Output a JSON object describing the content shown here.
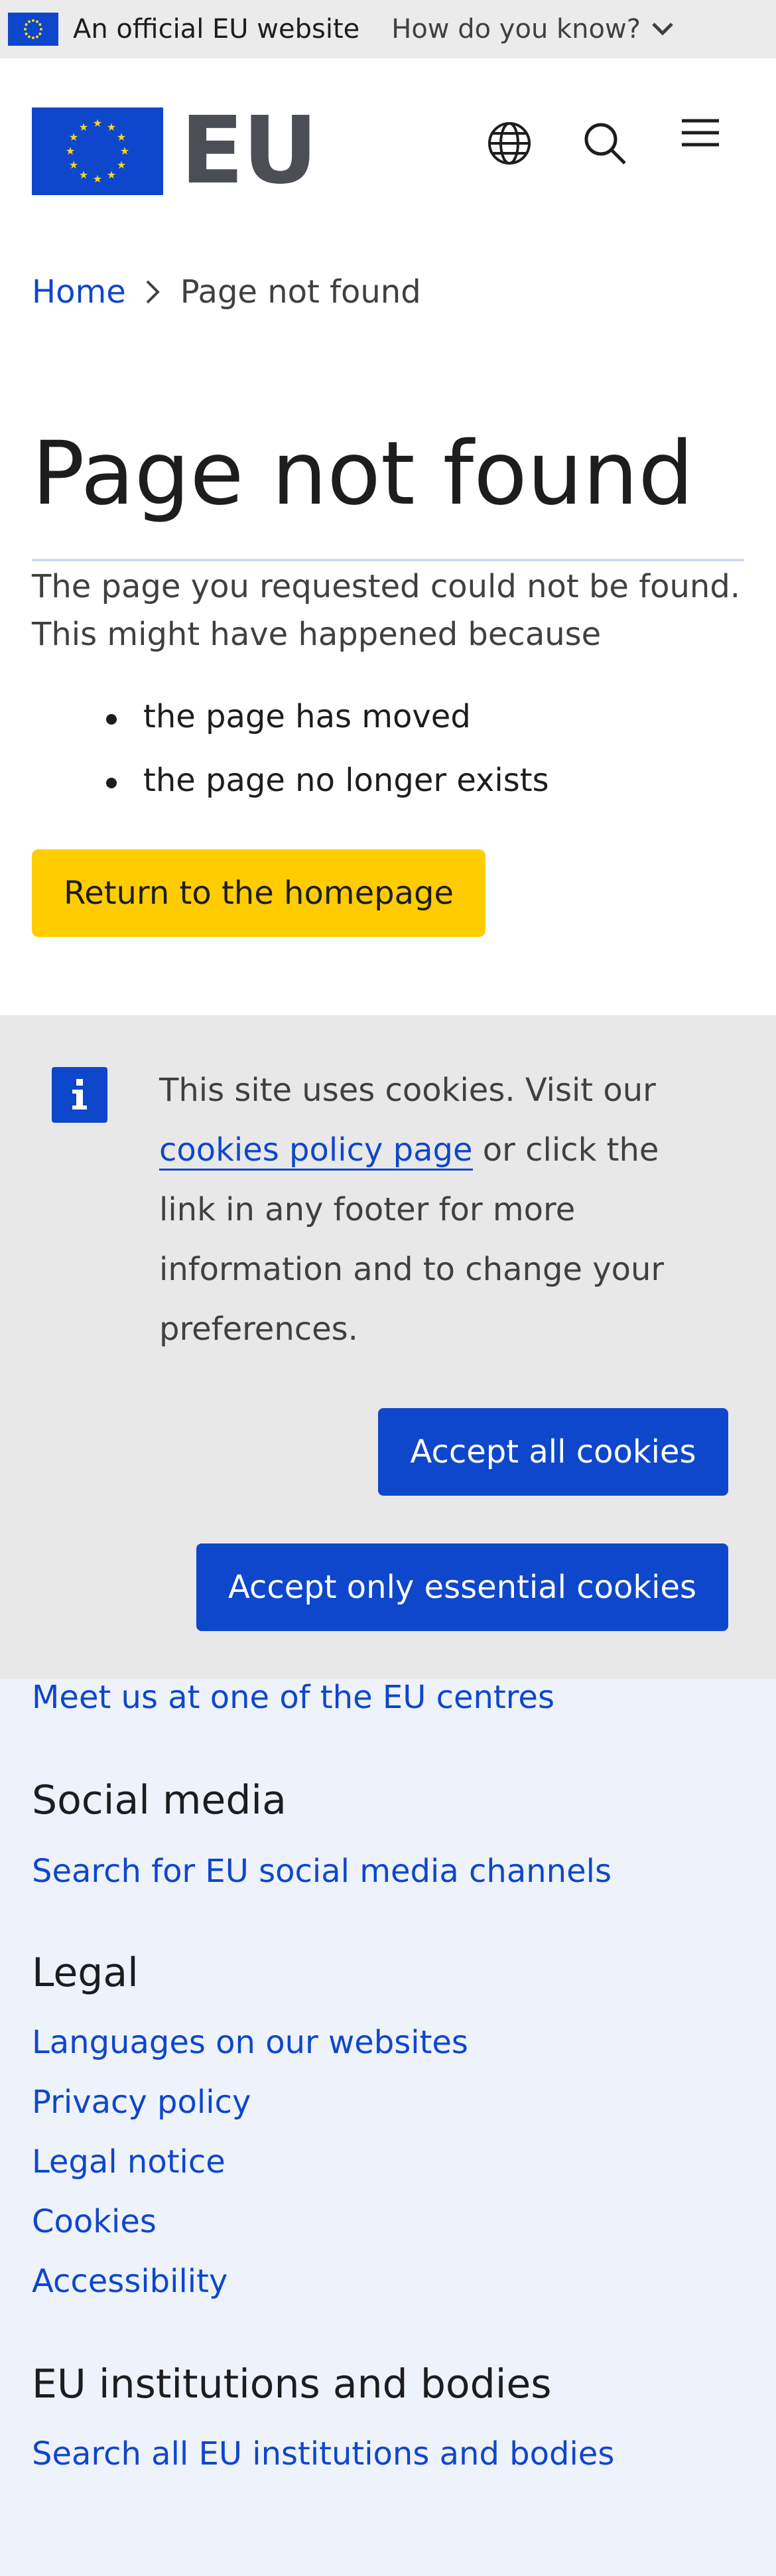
{
  "eu_band": {
    "official_text": "An official EU website",
    "how_text": "How do you know?"
  },
  "header": {
    "logo_text": "EU"
  },
  "breadcrumb": {
    "home": "Home",
    "current": "Page not found"
  },
  "main": {
    "title": "Page not found",
    "intro": "The page you requested could not be found. This might have happened because",
    "reasons": [
      "the page has moved",
      "the page no longer exists"
    ],
    "home_button": "Return to the homepage"
  },
  "cookie": {
    "text_before": "This site uses cookies. Visit our ",
    "link": "cookies policy page",
    "text_after": " or click the link in any footer for more information and to change your preferences.",
    "accept_all": "Accept all cookies",
    "accept_essential": "Accept only essential cookies"
  },
  "footer": {
    "centres_link": "Meet us at one of the EU centres",
    "social_heading": "Social media",
    "social_link": "Search for EU social media channels",
    "legal_heading": "Legal",
    "legal_links": [
      "Languages on our websites",
      "Privacy policy",
      "Legal notice",
      "Cookies",
      "Accessibility"
    ],
    "institutions_heading": "EU institutions and bodies",
    "institutions_link": "Search all EU institutions and bodies"
  },
  "colors": {
    "eu_blue": "#0e47cb",
    "accent_yellow": "#ffcc00",
    "star_yellow": "#ffd617",
    "band_grey": "#ebebeb",
    "cookie_grey": "#e8e8e8",
    "footer_bg": "#eef2fa"
  },
  "icons": {
    "flag": "eu-flag-icon",
    "chevron": "chevron-down-icon",
    "language": "globe-icon",
    "search": "search-icon",
    "menu": "hamburger-menu-icon",
    "breadcrumb_separator": "chevron-right-icon",
    "info": "info-icon"
  }
}
